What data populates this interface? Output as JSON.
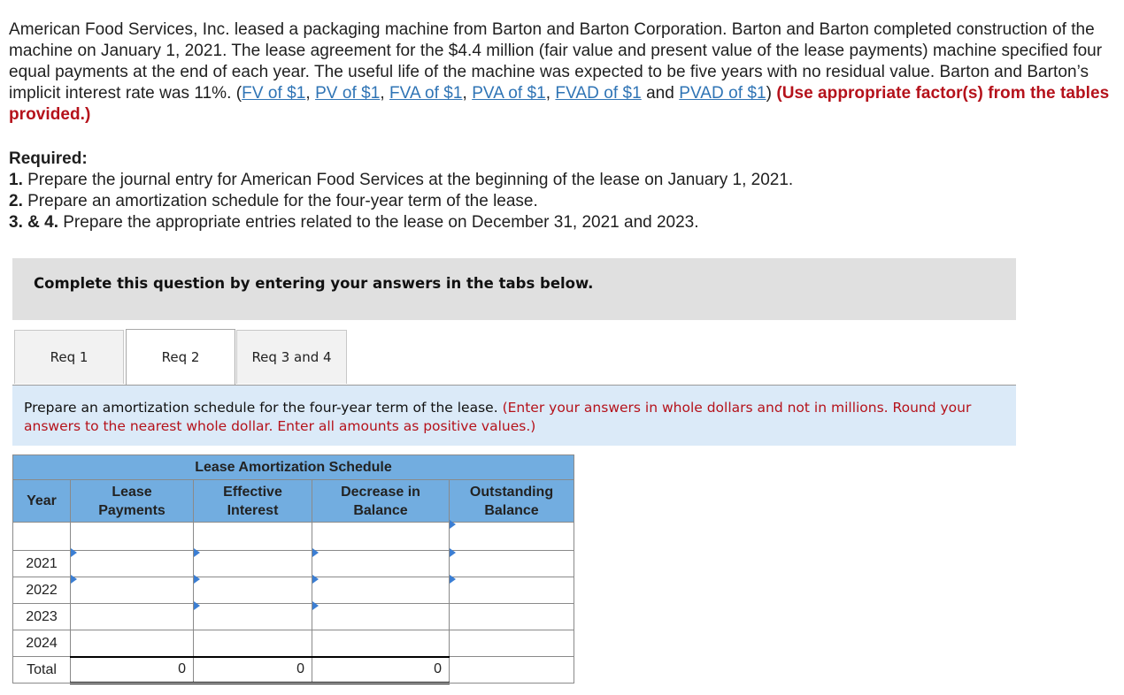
{
  "problem": {
    "text_before_links": "American Food Services, Inc. leased a packaging machine from Barton and Barton Corporation. Barton and Barton completed construction of the machine on January 1, 2021. The lease agreement for the $4.4 million (fair value and present value of the lease payments) machine specified four equal payments at the end of each year. The useful life of the machine was expected to be five years with no residual value. Barton and Barton’s implicit interest rate was 11%. (",
    "links": [
      "FV of $1",
      "PV of $1",
      "FVA of $1",
      "PVA of $1",
      "FVAD of $1",
      "PVAD of $1"
    ],
    "sep_comma": ", ",
    "sep_and": " and ",
    "close_paren": ") ",
    "note": "(Use appropriate factor(s) from the tables provided.)"
  },
  "required": {
    "heading": "Required:",
    "items": [
      {
        "num": "1.",
        "text": " Prepare the journal entry for American Food Services at the beginning of the lease on January 1, 2021."
      },
      {
        "num": "2.",
        "text": " Prepare an amortization schedule for the four-year term of the lease."
      },
      {
        "num": "3. & 4.",
        "text": " Prepare the appropriate entries related to the lease on December 31, 2021 and 2023."
      }
    ]
  },
  "banner": "Complete this question by entering your answers in the tabs below.",
  "tabs": [
    {
      "label": "Req 1",
      "active": false
    },
    {
      "label": "Req 2",
      "active": true
    },
    {
      "label": "Req 3 and 4",
      "active": false
    }
  ],
  "instructions": {
    "main": "Prepare an amortization schedule for the four-year term of the lease. ",
    "note": "(Enter your answers in whole dollars and not in millions. Round your answers to the nearest whole dollar. Enter all amounts as positive values.)"
  },
  "schedule": {
    "title": "Lease Amortization Schedule",
    "columns": [
      "Year",
      "Lease Payments",
      "Effective Interest",
      "Decrease in Balance",
      "Outstanding Balance"
    ],
    "rows": [
      {
        "year": "",
        "lease_payment": "",
        "effective_interest": "",
        "decrease": "",
        "outstanding": ""
      },
      {
        "year": "2021",
        "lease_payment": "",
        "effective_interest": "",
        "decrease": "",
        "outstanding": ""
      },
      {
        "year": "2022",
        "lease_payment": "",
        "effective_interest": "",
        "decrease": "",
        "outstanding": ""
      },
      {
        "year": "2023",
        "lease_payment": "",
        "effective_interest": "",
        "decrease": "",
        "outstanding": ""
      },
      {
        "year": "2024",
        "lease_payment": "",
        "effective_interest": "",
        "decrease": "",
        "outstanding": ""
      }
    ],
    "total": {
      "label": "Total",
      "lease_payments": "0",
      "effective_interest": "0",
      "decrease": "0"
    }
  },
  "colors": {
    "link": "#2f74b5",
    "warning_red": "#b5121b",
    "table_header": "#72ade0",
    "input_border": "#4a82c2",
    "instruction_bg": "#dbeaf8",
    "banner_bg": "#e0e0e0"
  }
}
